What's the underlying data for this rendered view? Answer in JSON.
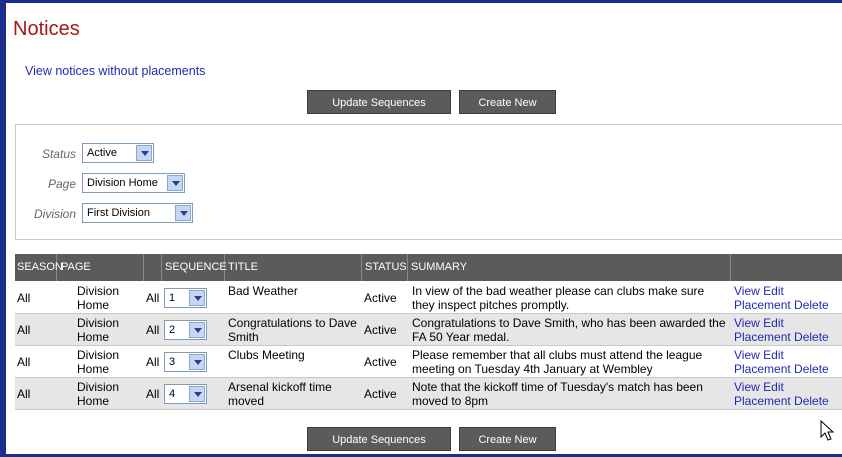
{
  "page": {
    "title": "Notices",
    "view_without_placements": "View notices without placements"
  },
  "buttons": {
    "update_sequences": "Update Sequences",
    "create_new": "Create New"
  },
  "filters": {
    "status_label": "Status",
    "status_value": "Active",
    "page_label": "Page",
    "page_value": "Division Home",
    "division_label": "Division",
    "division_value": "First Division"
  },
  "table": {
    "headers": [
      "SEASON",
      "PAGE",
      "",
      "SEQUENCE",
      "TITLE",
      "STATUS",
      "SUMMARY",
      ""
    ],
    "rows": [
      {
        "season": "All",
        "page": "Division Home",
        "scope": "All",
        "sequence": "1",
        "title": "Bad Weather",
        "status": "Active",
        "summary": "In view of the bad weather please can clubs make sure they inspect pitches promptly.",
        "actions": {
          "view": "View",
          "edit": "Edit",
          "placement": "Placement",
          "delete": "Delete"
        }
      },
      {
        "season": "All",
        "page": "Division Home",
        "scope": "All",
        "sequence": "2",
        "title": "Congratulations to Dave Smith",
        "status": "Active",
        "summary": "Congratulations to Dave Smith, who has been awarded the FA 50 Year medal.",
        "actions": {
          "view": "View",
          "edit": "Edit",
          "placement": "Placement",
          "delete": "Delete"
        }
      },
      {
        "season": "All",
        "page": "Division Home",
        "scope": "All",
        "sequence": "3",
        "title": "Clubs Meeting",
        "status": "Active",
        "summary": "Please remember that all clubs must attend the league meeting on Tuesday 4th January at Wembley",
        "actions": {
          "view": "View",
          "edit": "Edit",
          "placement": "Placement",
          "delete": "Delete"
        }
      },
      {
        "season": "All",
        "page": "Division Home",
        "scope": "All",
        "sequence": "4",
        "title": "Arsenal kickoff time moved",
        "status": "Active",
        "summary": "Note that the kickoff time of Tuesday's match has been moved to 8pm",
        "actions": {
          "view": "View",
          "edit": "Edit",
          "placement": "Placement",
          "delete": "Delete"
        }
      }
    ]
  },
  "colors": {
    "title": "#a11a1a",
    "link": "#1f2bb0",
    "header_bg": "#5b5b5b",
    "frame": "#1a2e8a",
    "alt_row": "#e6e6e6"
  },
  "icons": {
    "select_arrow": "chevron-down-icon",
    "cursor": "mouse-pointer-icon"
  }
}
